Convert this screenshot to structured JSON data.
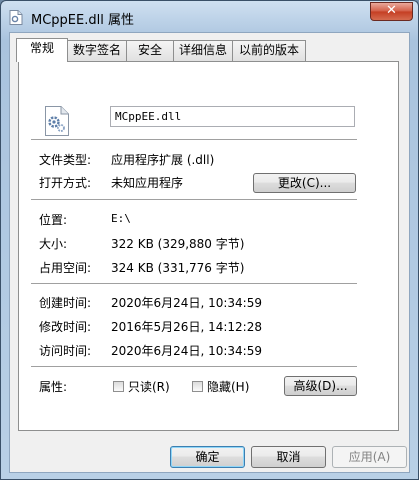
{
  "window": {
    "title": "MCppEE.dll 属性",
    "close_label": "✕"
  },
  "tabs": [
    {
      "label": "常规",
      "active": true
    },
    {
      "label": "数字签名",
      "active": false
    },
    {
      "label": "安全",
      "active": false
    },
    {
      "label": "详细信息",
      "active": false
    },
    {
      "label": "以前的版本",
      "active": false
    }
  ],
  "general": {
    "file_name": "MCppEE.dll",
    "file_type_label": "文件类型:",
    "file_type_value": "应用程序扩展 (.dll)",
    "open_with_label": "打开方式:",
    "open_with_value": "未知应用程序",
    "change_button": "更改(C)...",
    "location_label": "位置:",
    "location_value": "E:\\",
    "size_label": "大小:",
    "size_value": "322 KB (329,880 字节)",
    "size_on_disk_label": "占用空间:",
    "size_on_disk_value": "324 KB (331,776 字节)",
    "created_label": "创建时间:",
    "created_value": "2020年6月24日, 10:34:59",
    "modified_label": "修改时间:",
    "modified_value": "2016年5月26日, 14:12:28",
    "accessed_label": "访问时间:",
    "accessed_value": "2020年6月24日, 10:34:59",
    "attributes_label": "属性:",
    "readonly_label": "只读(R)",
    "hidden_label": "隐藏(H)",
    "advanced_button": "高级(D)...",
    "readonly_checked": false,
    "hidden_checked": false
  },
  "buttons": {
    "ok": "确定",
    "cancel": "取消",
    "apply": "应用(A)"
  }
}
